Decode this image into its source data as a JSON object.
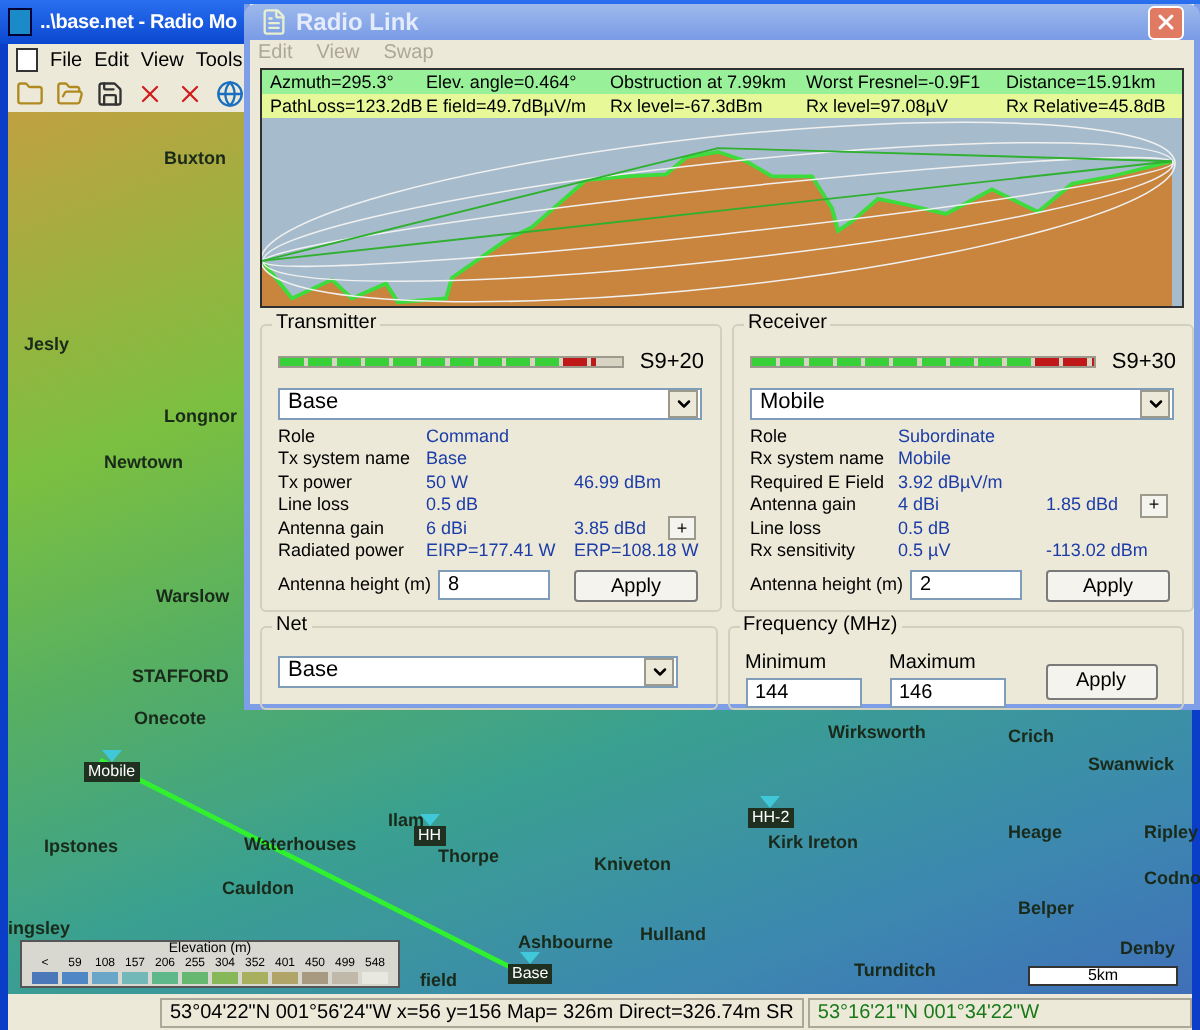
{
  "main_window": {
    "title": "..\\base.net - Radio Mo",
    "menu": [
      "File",
      "Edit",
      "View",
      "Tools"
    ]
  },
  "map": {
    "places": [
      "Buxton",
      "Jesly",
      "Longnor",
      "Newtown",
      "Warslow",
      "STAFFORD",
      "Onecote",
      "Ipstones",
      "Waterhouses",
      "Cauldon",
      "ingsley",
      "Ilam",
      "Thorpe",
      "Kniveton",
      "Kirk Ireton",
      "Ashbourne",
      "Hulland",
      "field",
      "Wirksworth",
      "Crich",
      "Swanwick",
      "Heage",
      "Ripley",
      "Codno",
      "Belper",
      "Denby",
      "Turnditch"
    ],
    "markers": [
      {
        "label": "Mobile"
      },
      {
        "label": "HH"
      },
      {
        "label": "HH-2"
      },
      {
        "label": "Base"
      }
    ],
    "legend": {
      "title": "Elevation (m)",
      "items": [
        {
          "label": "<",
          "color": "#4a78b8"
        },
        {
          "label": "59",
          "color": "#4f86c6"
        },
        {
          "label": "108",
          "color": "#6aa6c8"
        },
        {
          "label": "157",
          "color": "#72b8b8"
        },
        {
          "label": "206",
          "color": "#5fb88a"
        },
        {
          "label": "255",
          "color": "#66b870"
        },
        {
          "label": "304",
          "color": "#86b85a"
        },
        {
          "label": "352",
          "color": "#a8b060"
        },
        {
          "label": "401",
          "color": "#b0a468"
        },
        {
          "label": "450",
          "color": "#a89a80"
        },
        {
          "label": "499",
          "color": "#c0b8a8"
        },
        {
          "label": "548",
          "color": "#e8e8e0"
        }
      ]
    },
    "scale": "5km"
  },
  "status_bar": [
    "53°04'22\"N 001°56'24\"W  x=56 y=156 Map= 326m Direct=326.74m SR",
    "53°16'21\"N 001°34'22\"W"
  ],
  "dialog": {
    "title": "Radio Link",
    "menu": [
      {
        "label": "Edit",
        "disabled": true
      },
      {
        "label": "View",
        "disabled": true
      },
      {
        "label": "Swap",
        "disabled": true
      }
    ],
    "summary": [
      [
        "Azmuth=295.3°",
        "Elev. angle=0.464°",
        "Obstruction at 7.99km",
        "Worst Fresnel=-0.9F1",
        "Distance=15.91km"
      ],
      [
        "PathLoss=123.2dB",
        "E field=49.7dBµV/m",
        "Rx level=-67.3dBm",
        "Rx level=97.08µV",
        "Rx Relative=45.8dB"
      ]
    ],
    "transmitter": {
      "title": "Transmitter",
      "meter": {
        "level": 0.923,
        "reading": "S9+20"
      },
      "system": "Base",
      "rows": [
        {
          "label": "Role",
          "value": "Command"
        },
        {
          "label": "Tx system name",
          "value": "Base"
        },
        {
          "label": "Tx power",
          "value": "50 W",
          "value_2": "46.99 dBm"
        },
        {
          "label": "Line loss",
          "value": "0.5 dB"
        },
        {
          "label": "Antenna gain",
          "value": "6 dBi",
          "value_2": "3.85 dBd",
          "button": "+"
        },
        {
          "label": "Radiated power",
          "value": "EIRP=177.41 W",
          "value_2": "ERP=108.18 W"
        }
      ],
      "antenna_height": {
        "label": "Antenna height (m)",
        "value": "8"
      },
      "apply": "Apply"
    },
    "receiver": {
      "title": "Receiver",
      "meter": {
        "level": 1,
        "reading": "S9+30"
      },
      "system": "Mobile",
      "rows": [
        {
          "label": "Role",
          "value": "Subordinate"
        },
        {
          "label": "Rx system name",
          "value": "Mobile"
        },
        {
          "label": "Required E Field",
          "value": "3.92 dBµV/m"
        },
        {
          "label": "Antenna gain",
          "value": "4 dBi",
          "value_2": "1.85 dBd",
          "button": "+"
        },
        {
          "label": "Line loss",
          "value": "0.5 dB"
        },
        {
          "label": "Rx sensitivity",
          "value": "0.5 µV",
          "value_2": "-113.02 dBm"
        }
      ],
      "antenna_height": {
        "label": "Antenna height (m)",
        "value": "2"
      },
      "apply": "Apply"
    },
    "net": {
      "title": "Net",
      "value": "Base"
    },
    "frequency": {
      "title": "Frequency (MHz)",
      "minimum": {
        "label": "Minimum",
        "value": "144"
      },
      "maximum": {
        "label": "Maximum",
        "value": "146"
      },
      "apply": "Apply"
    }
  }
}
